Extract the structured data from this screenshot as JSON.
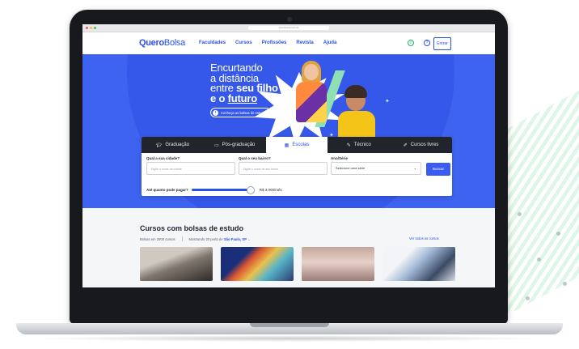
{
  "browser": {
    "url": "querobolsa.com.br"
  },
  "header": {
    "logo_bold": "Quero",
    "logo_regular": "Bolsa",
    "nav": [
      "Faculdades",
      "Cursos",
      "Profissões",
      "Revista",
      "Ajuda"
    ],
    "enter_label": "Entrar"
  },
  "hero": {
    "line1": "Encurtando",
    "line2": "a distância",
    "line3_prefix": "entre ",
    "line3_bold": "seu filho",
    "line4_bold": "e o ",
    "line4_underline": "futuro",
    "cta_label": "Conheça as bolsas de estudo"
  },
  "search": {
    "tabs": [
      {
        "label": "Graduação",
        "icon": "graduation-cap-icon"
      },
      {
        "label": "Pós-graduação",
        "icon": "briefcase-icon"
      },
      {
        "label": "Escolas",
        "icon": "school-icon",
        "active": true
      },
      {
        "label": "Técnico",
        "icon": "tools-icon"
      },
      {
        "label": "Cursos livres",
        "icon": "pencil-icon"
      }
    ],
    "city_label": "Qual a sua cidade?",
    "city_placeholder": "Digite o nome da cidade",
    "district_label": "Qual o seu bairro?",
    "district_placeholder": "Digite o nome de seu bairro",
    "grade_label": "Ano/Série",
    "grade_value": "Selecione uma série",
    "search_button": "Buscar",
    "price_label": "Até quanto pode pagar?",
    "price_value": "R$ 3.000/mês",
    "price_fraction": 1.0
  },
  "courses": {
    "title": "Cursos com bolsas de estudo",
    "count_text": "Bolsas em 2000 cursos",
    "location_prefix": "Mostrando 20 perto de ",
    "location": "São Paulo, SP",
    "see_all": "Ver todos os cursos"
  },
  "colors": {
    "brand": "#2b50e8",
    "hero_bg": "#3e63f0",
    "tab_dark": "#21252b"
  }
}
